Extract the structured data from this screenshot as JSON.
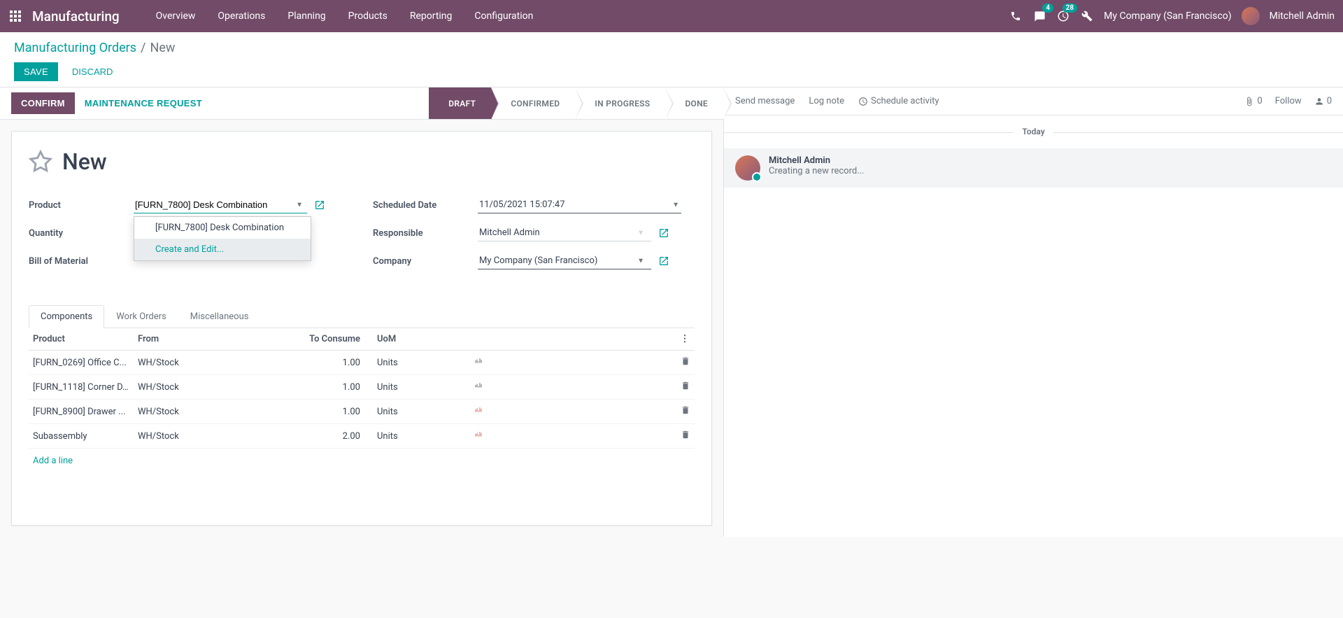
{
  "topbar": {
    "brand": "Manufacturing",
    "menu": [
      "Overview",
      "Operations",
      "Planning",
      "Products",
      "Reporting",
      "Configuration"
    ],
    "chat_count": "4",
    "activity_count": "28",
    "company": "My Company (San Francisco)",
    "user": "Mitchell Admin"
  },
  "breadcrumb": {
    "root": "Manufacturing Orders",
    "current": "New"
  },
  "buttons": {
    "save": "Save",
    "discard": "Discard",
    "confirm": "Confirm",
    "maintenance": "Maintenance Request"
  },
  "status": {
    "draft": "Draft",
    "confirmed": "Confirmed",
    "in_progress": "In Progress",
    "done": "Done"
  },
  "record": {
    "title": "New",
    "product_label": "Product",
    "product_value": "[FURN_7800] Desk Combination",
    "quantity_label": "Quantity",
    "bom_label": "Bill of Material",
    "sched_label": "Scheduled Date",
    "sched_value": "11/05/2021 15:07:47",
    "resp_label": "Responsible",
    "resp_value": "Mitchell Admin",
    "company_label": "Company",
    "company_value": "My Company (San Francisco)"
  },
  "dropdown": {
    "option1": "[FURN_7800] Desk Combination",
    "create_edit": "Create and Edit..."
  },
  "tabs": {
    "components": "Components",
    "work_orders": "Work Orders",
    "misc": "Miscellaneous"
  },
  "table": {
    "headers": {
      "product": "Product",
      "from": "From",
      "to_consume": "To Consume",
      "uom": "UoM"
    },
    "rows": [
      {
        "product": "[FURN_0269] Office C...",
        "from": "WH/Stock",
        "to_consume": "1.00",
        "uom": "Units",
        "warn": false
      },
      {
        "product": "[FURN_1118] Corner D...",
        "from": "WH/Stock",
        "to_consume": "1.00",
        "uom": "Units",
        "warn": false
      },
      {
        "product": "[FURN_8900] Drawer ...",
        "from": "WH/Stock",
        "to_consume": "1.00",
        "uom": "Units",
        "warn": true
      },
      {
        "product": "Subassembly",
        "from": "WH/Stock",
        "to_consume": "2.00",
        "uom": "Units",
        "warn": true
      }
    ],
    "add_line": "Add a line"
  },
  "chatter": {
    "send": "Send message",
    "log": "Log note",
    "schedule": "Schedule activity",
    "attach_count": "0",
    "follow": "Follow",
    "follower_count": "0",
    "today": "Today",
    "msg_author": "Mitchell Admin",
    "msg_body": "Creating a new record..."
  }
}
